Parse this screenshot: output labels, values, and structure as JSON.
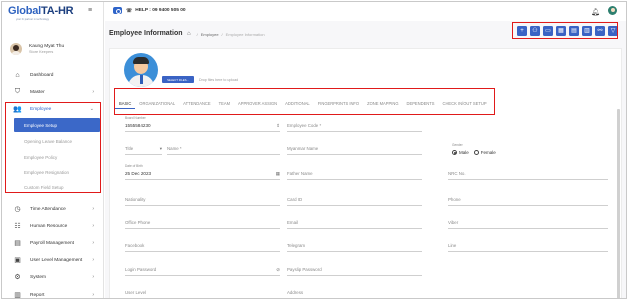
{
  "brand": {
    "logo_main": "Global",
    "logo_hr": "TA-HR",
    "tagline": "your hr partner in technology"
  },
  "sidebar": {
    "profile": {
      "name": "Kaung Myat Thu",
      "role": "Store Keepers"
    },
    "items": [
      {
        "label": "Dashboard",
        "icon": "home-icon"
      },
      {
        "label": "Master",
        "icon": "shield-icon"
      },
      {
        "label": "Employee",
        "icon": "people-icon"
      },
      {
        "label": "Time Attendance",
        "icon": "clock-icon"
      },
      {
        "label": "Human Resource",
        "icon": "person-card-icon"
      },
      {
        "label": "Payroll Management",
        "icon": "cash-icon"
      },
      {
        "label": "User Level Management",
        "icon": "id-card-icon"
      },
      {
        "label": "System",
        "icon": "gear-icon"
      },
      {
        "label": "Report",
        "icon": "report-icon"
      }
    ],
    "employee_sub": [
      "Employee Setup",
      "Opening Leave Balance",
      "Employee Policy",
      "Employee Resignation",
      "Custom Field Setup"
    ]
  },
  "topbar": {
    "help": "HELP : 09 9400 505 00"
  },
  "page": {
    "title": "Employee Information",
    "breadcrumb": [
      "Employee",
      "Employee Information"
    ]
  },
  "toolbar_icons": [
    "plus-icon",
    "user-add-icon",
    "id-card-icon",
    "calculator-icon",
    "document-icon",
    "grid-icon",
    "org-chart-icon",
    "filter-icon"
  ],
  "photo": {
    "select_button": "SELECT FILES...",
    "drop_hint": "Drop files here to upload"
  },
  "tabs": [
    "BASIC",
    "ORGANIZATIONAL",
    "ATTENDANCE",
    "TEAM",
    "APPROVER ASSIGN",
    "ADDITIONAL",
    "FINGERPRINTS INFO",
    "ZONE MAPPING",
    "DEPENDENTS",
    "CHECK IN/OUT SETUP"
  ],
  "form": {
    "row1": {
      "board_label": "Board Number",
      "board_value": "1555584230",
      "emp_code": "Employee Code *"
    },
    "row2": {
      "title": "Title",
      "name": "Name *",
      "myanmar_name": "Myanmar Name",
      "gender_label": "Gender",
      "male": "Male",
      "female": "Female"
    },
    "row3": {
      "dob_label": "Date of Birth",
      "dob_value": "25 Dec 2023",
      "father_name": "Father Name",
      "nrc": "NRC No."
    },
    "row4": {
      "nationality": "Nationality",
      "card_id": "Card ID",
      "phone": "Phone"
    },
    "row5": {
      "office_phone": "Office Phone",
      "email": "Email",
      "viber": "Viber"
    },
    "row6": {
      "facebook": "Facebook",
      "telegram": "Telegram",
      "line": "Line"
    },
    "row7": {
      "login_password": "Login Password",
      "payslip_password": "Payslip Password"
    },
    "row8": {
      "user_level": "User Level",
      "address": "Address"
    }
  }
}
